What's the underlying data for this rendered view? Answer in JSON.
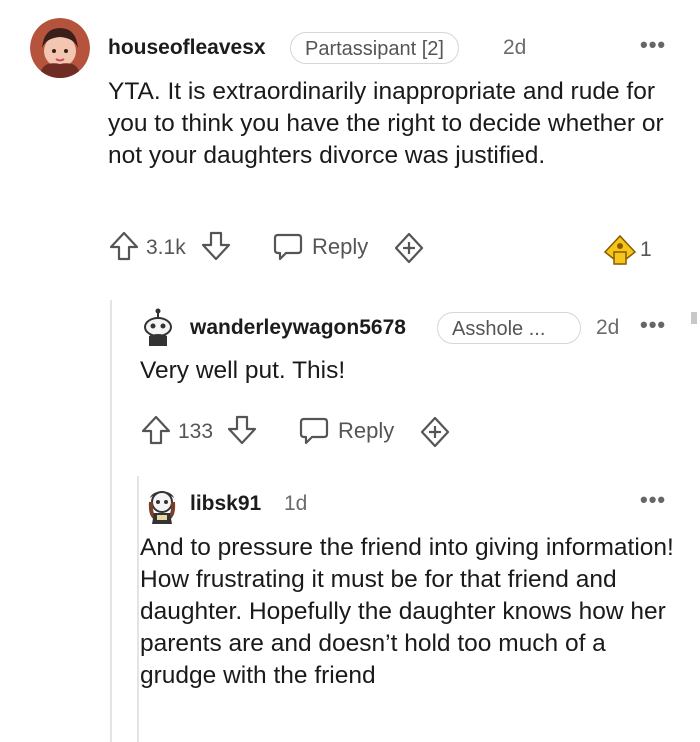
{
  "comments": [
    {
      "username": "houseofleavesx",
      "flair": "Partassipant [2]",
      "time": "2d",
      "text": "YTA. It is extraordinarily inappropriate and rude for you to think you have the right to decide whether or not your daughters divorce was justified.",
      "votes": "3.1k",
      "reply_label": "Reply",
      "award_count": "1"
    },
    {
      "username": "wanderleywagon5678",
      "flair": "Asshole ...",
      "time": "2d",
      "text": "Very well put. This!",
      "votes": "133",
      "reply_label": "Reply"
    },
    {
      "username": "libsk91",
      "time": "1d",
      "text": "And to pressure the friend into giving information! How frustrating it must be for that friend and daughter. Hopefully the daughter knows how her parents are and doesn’t hold too much of a grudge with the friend"
    }
  ],
  "colors": {
    "award_gold": "#f5c518",
    "text": "#1a1a1b",
    "meta": "#6b6b6b"
  },
  "icons": [
    "more-options-icon",
    "upvote-icon",
    "downvote-icon",
    "reply-icon",
    "award-icon",
    "gold-award-icon"
  ]
}
